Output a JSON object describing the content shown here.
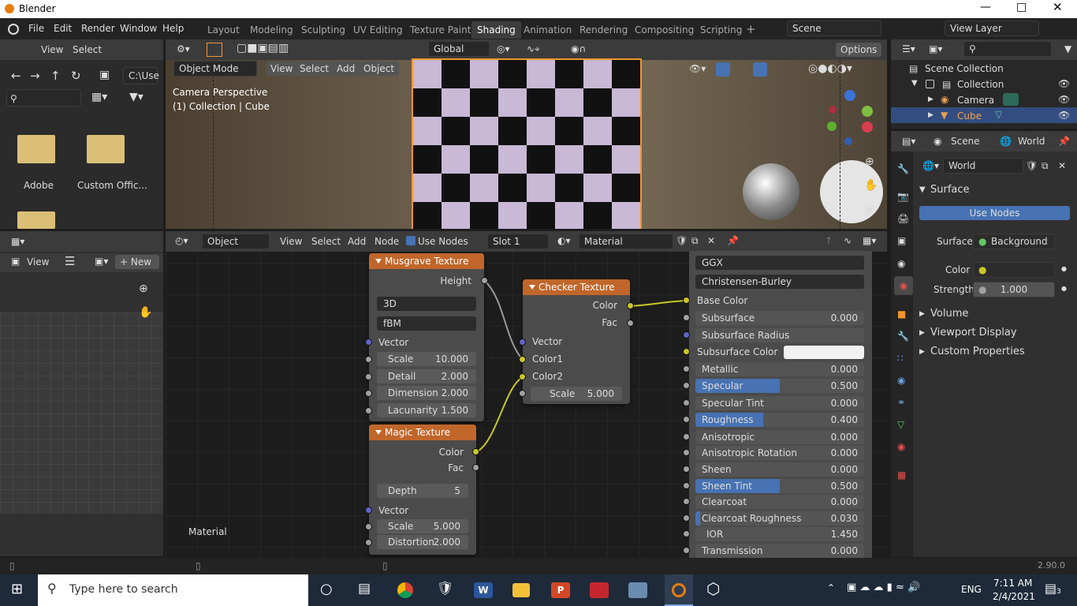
{
  "window": {
    "title": "Blender"
  },
  "menu": [
    "File",
    "Edit",
    "Render",
    "Window",
    "Help"
  ],
  "workspaces": [
    "Layout",
    "Modeling",
    "Sculpting",
    "UV Editing",
    "Texture Paint",
    "Shading",
    "Animation",
    "Rendering",
    "Compositing",
    "Scripting"
  ],
  "active_workspace": "Shading",
  "scene_field": "Scene",
  "view_layer_field": "View Layer",
  "file_browser": {
    "menu": [
      "View",
      "Select"
    ],
    "path": "C:\\Use",
    "folders": [
      "Adobe",
      "Custom Offic..."
    ]
  },
  "viewport": {
    "mode": "Object Mode",
    "menu": [
      "View",
      "Select",
      "Add",
      "Object"
    ],
    "transform": "Global",
    "options": "Options",
    "info1": "Camera Perspective",
    "info2": "(1) Collection | Cube"
  },
  "image_editor": {
    "view": "View",
    "new": "New"
  },
  "node_editor": {
    "type": "Object",
    "menu": [
      "View",
      "Select",
      "Add",
      "Node"
    ],
    "use_nodes": "Use Nodes",
    "slot": "Slot 1",
    "material": "Material",
    "label": "Material",
    "musgrave": {
      "title": "Musgrave Texture",
      "out": "Height",
      "dim": "3D",
      "type": "fBM",
      "vector": "Vector",
      "fields": [
        [
          "Scale",
          "10.000"
        ],
        [
          "Detail",
          "2.000"
        ],
        [
          "Dimension",
          "2.000"
        ],
        [
          "Lacunarity",
          "1.500"
        ]
      ]
    },
    "magic": {
      "title": "Magic Texture",
      "out1": "Color",
      "out2": "Fac",
      "depth_label": "Depth",
      "depth": "5",
      "vector": "Vector",
      "fields": [
        [
          "Scale",
          "5.000"
        ],
        [
          "Distortion",
          "2.000"
        ]
      ]
    },
    "checker": {
      "title": "Checker Texture",
      "out1": "Color",
      "out2": "Fac",
      "in": [
        "Vector",
        "Color1",
        "Color2"
      ],
      "scale_label": "Scale",
      "scale": "5.000"
    },
    "bsdf": {
      "dist": "GGX",
      "sss": "Christensen-Burley",
      "base_color": "Base Color",
      "subsurface_radius": "Subsurface Radius",
      "subsurface_color": "Subsurface Color",
      "rows": [
        {
          "label": "Subsurface",
          "value": "0.000",
          "fill": 0
        },
        {
          "label": "Metallic",
          "value": "0.000",
          "fill": 0
        },
        {
          "label": "Specular",
          "value": "0.500",
          "fill": 0.5
        },
        {
          "label": "Specular Tint",
          "value": "0.000",
          "fill": 0
        },
        {
          "label": "Roughness",
          "value": "0.400",
          "fill": 0.4
        },
        {
          "label": "Anisotropic",
          "value": "0.000",
          "fill": 0
        },
        {
          "label": "Anisotropic Rotation",
          "value": "0.000",
          "fill": 0
        },
        {
          "label": "Sheen",
          "value": "0.000",
          "fill": 0
        },
        {
          "label": "Sheen Tint",
          "value": "0.500",
          "fill": 0.5
        },
        {
          "label": "Clearcoat",
          "value": "0.000",
          "fill": 0
        },
        {
          "label": "Clearcoat Roughness",
          "value": "0.030",
          "fill": 0.03
        },
        {
          "label": "IOR",
          "value": "1.450",
          "fill": 0
        },
        {
          "label": "Transmission",
          "value": "0.000",
          "fill": 0
        }
      ]
    }
  },
  "outliner": {
    "root": "Scene Collection",
    "collection": "Collection",
    "items": [
      "Camera",
      "Cube"
    ]
  },
  "properties": {
    "tab1": "Scene",
    "tab2": "World",
    "world": "World",
    "surface_panel": "Surface",
    "use_nodes": "Use Nodes",
    "surface_label": "Surface",
    "surface_value": "Background",
    "color_label": "Color",
    "strength_label": "Strength",
    "strength": "1.000",
    "panels": [
      "Volume",
      "Viewport Display",
      "Custom Properties"
    ]
  },
  "status": {
    "version": "2.90.0"
  },
  "taskbar": {
    "search": "Type here to search",
    "lang": "ENG",
    "time": "7:11 AM",
    "date": "2/4/2021",
    "notif": "3"
  }
}
